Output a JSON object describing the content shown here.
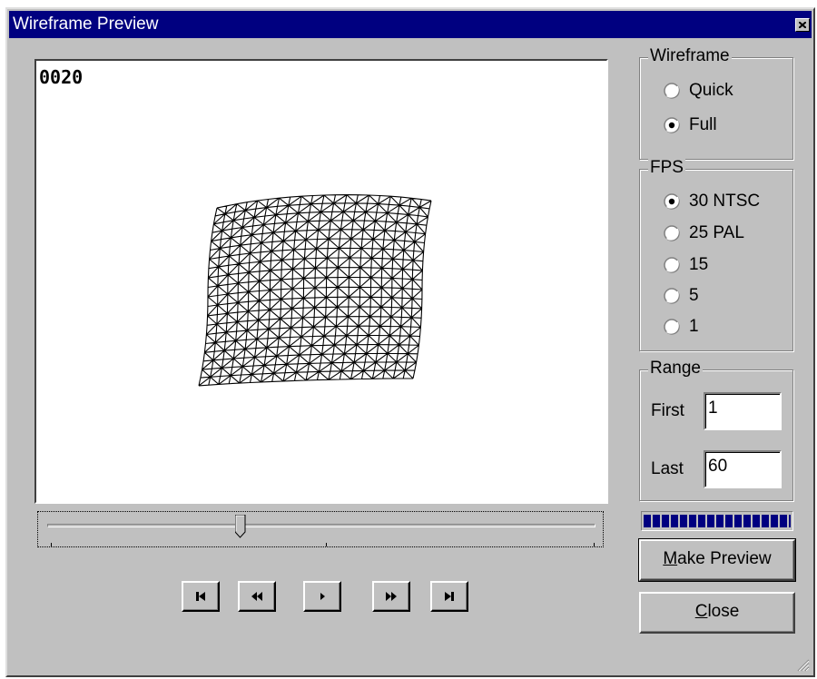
{
  "window": {
    "title": "Wireframe Preview",
    "close_icon": "close-icon"
  },
  "preview": {
    "frame_counter": "0020"
  },
  "timeline": {
    "position": 0.35
  },
  "transport": {
    "buttons": [
      {
        "name": "first-frame-button",
        "icon": "skip-to-start-icon"
      },
      {
        "name": "rewind-button",
        "icon": "rewind-icon"
      },
      {
        "name": "play-button",
        "icon": "play-icon"
      },
      {
        "name": "fast-forward-button",
        "icon": "fast-forward-icon"
      },
      {
        "name": "last-frame-button",
        "icon": "skip-to-end-icon"
      }
    ]
  },
  "wireframe": {
    "label": "Wireframe",
    "options": [
      {
        "label": "Quick",
        "selected": false
      },
      {
        "label": "Full",
        "selected": true
      }
    ]
  },
  "fps": {
    "label": "FPS",
    "options": [
      {
        "label": "30 NTSC",
        "selected": true
      },
      {
        "label": "25 PAL",
        "selected": false
      },
      {
        "label": "15",
        "selected": false
      },
      {
        "label": "5",
        "selected": false
      },
      {
        "label": "1",
        "selected": false
      }
    ]
  },
  "range": {
    "label": "Range",
    "first_label": "First",
    "first_value": "1",
    "last_label": "Last",
    "last_value": "60"
  },
  "progress": {
    "fraction": 1.0
  },
  "buttons": {
    "make_preview_pre": "M",
    "make_preview_rest": "ake Preview",
    "close_pre": "C",
    "close_rest": "lose"
  },
  "colors": {
    "titlebar": "#000080",
    "face": "#c0c0c0",
    "progress": "#000080"
  }
}
